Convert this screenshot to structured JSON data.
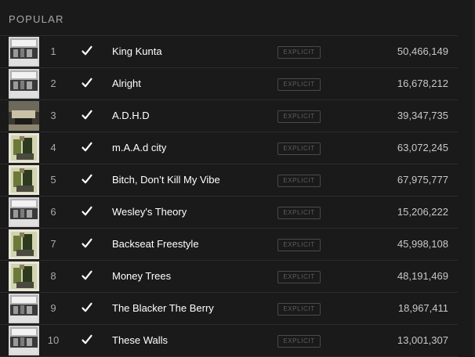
{
  "section": {
    "heading": "POPULAR"
  },
  "tracks": [
    {
      "number": "1",
      "title": "King Kunta",
      "explicit_label": "EXPLICIT",
      "plays": "50,466,149",
      "cover": "album-cover-bw"
    },
    {
      "number": "2",
      "title": "Alright",
      "explicit_label": "EXPLICIT",
      "plays": "16,678,212",
      "cover": "album-cover-bw"
    },
    {
      "number": "3",
      "title": "A.D.H.D",
      "explicit_label": "EXPLICIT",
      "plays": "39,347,735",
      "cover": "album-cover-dark"
    },
    {
      "number": "4",
      "title": "m.A.A.d city",
      "explicit_label": "EXPLICIT",
      "plays": "63,072,245",
      "cover": "album-cover-color"
    },
    {
      "number": "5",
      "title": "Bitch, Don’t Kill My Vibe",
      "explicit_label": "EXPLICIT",
      "plays": "67,975,777",
      "cover": "album-cover-color"
    },
    {
      "number": "6",
      "title": "Wesley's Theory",
      "explicit_label": "EXPLICIT",
      "plays": "15,206,222",
      "cover": "album-cover-bw"
    },
    {
      "number": "7",
      "title": "Backseat Freestyle",
      "explicit_label": "EXPLICIT",
      "plays": "45,998,108",
      "cover": "album-cover-color"
    },
    {
      "number": "8",
      "title": "Money Trees",
      "explicit_label": "EXPLICIT",
      "plays": "48,191,469",
      "cover": "album-cover-color"
    },
    {
      "number": "9",
      "title": "The Blacker The Berry",
      "explicit_label": "EXPLICIT",
      "plays": "18,967,411",
      "cover": "album-cover-bw"
    },
    {
      "number": "10",
      "title": "These Walls",
      "explicit_label": "EXPLICIT",
      "plays": "13,001,307",
      "cover": "album-cover-bw"
    }
  ],
  "icons": {
    "saved": "checkmark-icon"
  },
  "colors": {
    "background": "#1a1a1a",
    "row_divider": "#2c2c2c",
    "title_text": "#ffffff",
    "muted_text": "#a8a8a8",
    "explicit_badge": "#5e5e5e"
  }
}
